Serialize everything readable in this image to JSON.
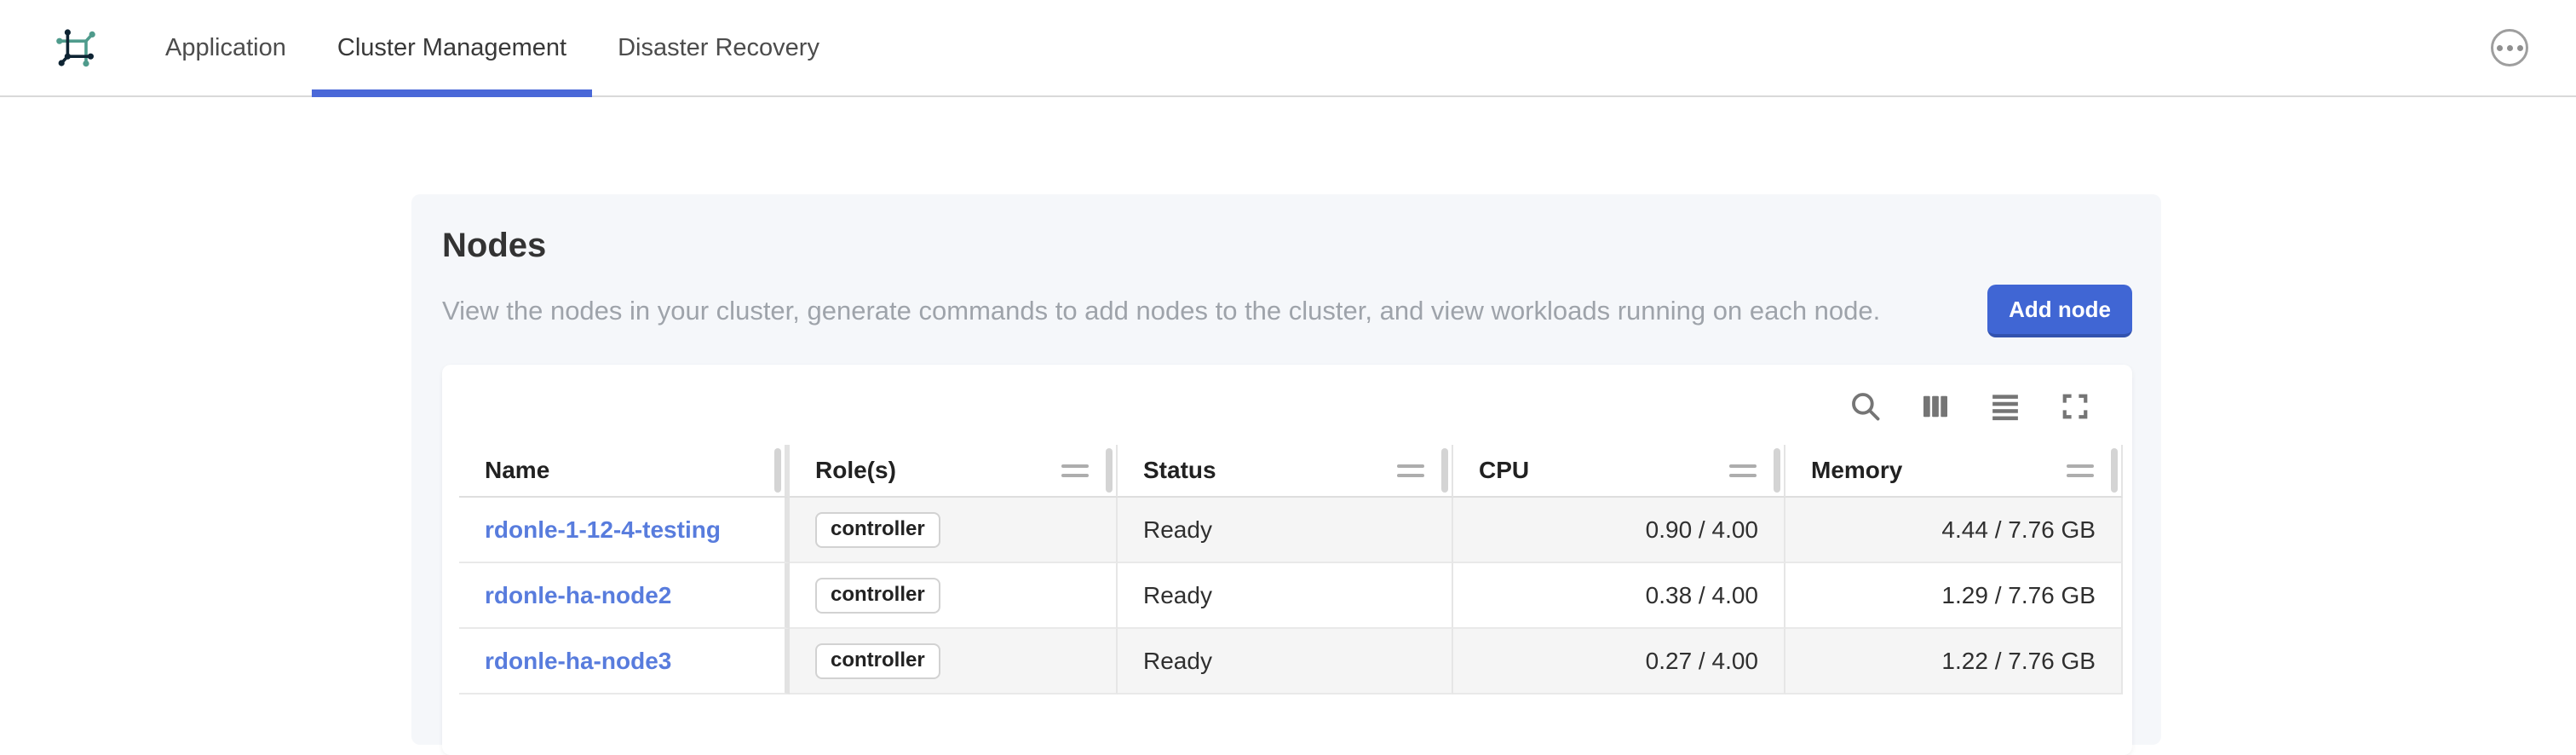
{
  "nav": {
    "tabs": [
      {
        "label": "Application",
        "active": false
      },
      {
        "label": "Cluster Management",
        "active": true
      },
      {
        "label": "Disaster Recovery",
        "active": false
      }
    ],
    "overflow_menu": "more-options"
  },
  "page": {
    "title": "Nodes",
    "description": "View the nodes in your cluster, generate commands to add nodes to the cluster, and view workloads running on each node.",
    "add_node_button": "Add node"
  },
  "table": {
    "toolbar_icons": [
      "search-icon",
      "show-hide-columns-icon",
      "toggle-density-icon",
      "toggle-fullscreen-icon"
    ],
    "columns": [
      "Name",
      "Role(s)",
      "Status",
      "CPU",
      "Memory"
    ],
    "rows": [
      {
        "name": "rdonle-1-12-4-testing",
        "role": "controller",
        "status": "Ready",
        "cpu": "0.90 / 4.00",
        "memory": "4.44 / 7.76 GB"
      },
      {
        "name": "rdonle-ha-node2",
        "role": "controller",
        "status": "Ready",
        "cpu": "0.38 / 4.00",
        "memory": "1.29 / 7.76 GB"
      },
      {
        "name": "rdonle-ha-node3",
        "role": "controller",
        "status": "Ready",
        "cpu": "0.27 / 4.00",
        "memory": "1.22 / 7.76 GB"
      }
    ]
  },
  "colors": {
    "accent_blue": "#4066d4",
    "link_blue": "#587cdd",
    "tab_underline": "#4a68d8",
    "logo_navy": "#0e2433",
    "logo_teal": "#4f9b8c",
    "panel_bg": "#f5f7fa",
    "row_stripe": "#f5f5f5"
  }
}
